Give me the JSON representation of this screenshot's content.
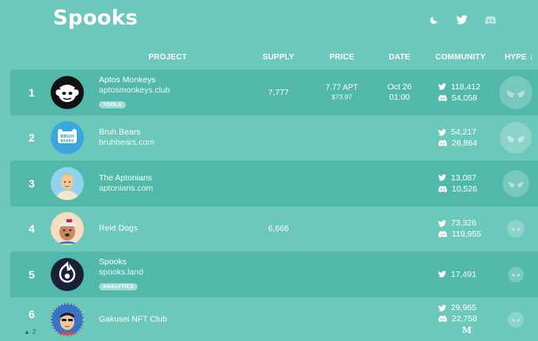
{
  "app": {
    "title": "Spooks"
  },
  "top_icons": [
    "moon-icon",
    "twitter-icon",
    "discord-icon"
  ],
  "columns": {
    "project": "PROJECT",
    "supply": "SUPPLY",
    "price": "PRICE",
    "date": "DATE",
    "community": "COMMUNITY",
    "hype": "HYPE ↓"
  },
  "colors": {
    "background": "#6cc8bb",
    "row_highlight": "#52b9aa",
    "text": "#ffffff",
    "rank_change": "#1f6b5b"
  },
  "rows": [
    {
      "rank": "1",
      "name": "Aptos Monkeys",
      "site": "aptosmonkeys.club",
      "tag": "TOOLS",
      "supply": "7,777",
      "price_apt": "7.77 APT",
      "price_usd": "$73.97",
      "date_day": "Oct 26",
      "date_time": "01:00",
      "twitter": "118,412",
      "discord": "54,058",
      "hype_level": 1.0
    },
    {
      "rank": "2",
      "name": "Bruh Bears",
      "site": "bruhbears.com",
      "avatar_text": "BRUH BEARS",
      "twitter": "54,217",
      "discord": "26,864",
      "hype_level": 0.95
    },
    {
      "rank": "3",
      "name": "The Aptonians",
      "site": "aptonians.com",
      "twitter": "13,087",
      "discord": "10,526",
      "hype_level": 0.8
    },
    {
      "rank": "4",
      "name": "Rekt Dogs",
      "supply": "6,666",
      "twitter": "73,326",
      "discord": "119,955",
      "hype_level": 0.5
    },
    {
      "rank": "5",
      "name": "Spooks",
      "site": "spooks.land",
      "tag": "ANALYTICS",
      "twitter": "17,491",
      "hype_level": 0.45
    },
    {
      "rank": "6",
      "rank_change": "2",
      "name": "Gakusei NFT Club",
      "twitter": "29,965",
      "discord": "22,758",
      "extra_link": "M",
      "hype_level": 0.45
    }
  ]
}
